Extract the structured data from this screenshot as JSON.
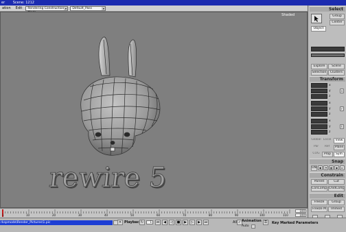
{
  "window": {
    "title_left": "er",
    "scene_label": "Scene: 1212"
  },
  "menubar": {
    "items": [
      "ation",
      "Edit"
    ],
    "mode_combo": "Rendering Construction Mode",
    "pass_combo": "Default_Pass"
  },
  "viewport": {
    "label": "Shaded",
    "model_text": "rewire 5"
  },
  "sidepanel": {
    "select": {
      "header": "Select",
      "group": "Group",
      "center": "Center",
      "object": "Object",
      "explore": "Explore",
      "scene": "Scene",
      "selection": "Selection",
      "clusters": "Clusters"
    },
    "transform": {
      "header": "Transform",
      "axes": [
        "x",
        "y",
        "z",
        "x",
        "y",
        "z",
        "x",
        "y",
        "z"
      ],
      "knobs": [
        "s",
        "r",
        "t"
      ],
      "global": "Global",
      "local": "Local",
      "view": "View",
      "par": "Par",
      "ref": "Ref",
      "plane": "Plane",
      "cog": "COG",
      "prop": "Prop",
      "sym": "Sym"
    },
    "snap": {
      "header": "Snap",
      "on": "ON"
    },
    "constrain": {
      "header": "Constrain",
      "parent": "Parent",
      "cut": "Cut",
      "concomp": "ConComp",
      "chldcomp": "ChldComp"
    },
    "edit": {
      "header": "Edit",
      "freeze": "Freeze",
      "group": "Group",
      "freeze_m": "Freeze M",
      "immed": "Immed"
    },
    "bottom": [
      "MCP",
      "KP/L",
      "MAT"
    ]
  },
  "timeline": {
    "ticks": [
      "1",
      "10",
      "20",
      "30",
      "40",
      "50",
      "60",
      "70",
      "80",
      "90",
      "100",
      "110"
    ],
    "start": "1",
    "end_a": "100",
    "end_b": "100"
  },
  "statusbar": {
    "path": "rkspmode\\Render_Pictures\\1.pic",
    "playback": "Playback",
    "frame": "1",
    "all": "All",
    "animation": "Animation",
    "auto": "Auto",
    "key_params": "Key Marked Parameters"
  },
  "colors": {
    "titlebar": "#1c2bb0",
    "viewport_bg": "#7f7f7f",
    "panel_bg": "#bdbdbd",
    "path_highlight": "#1d3ed4"
  }
}
